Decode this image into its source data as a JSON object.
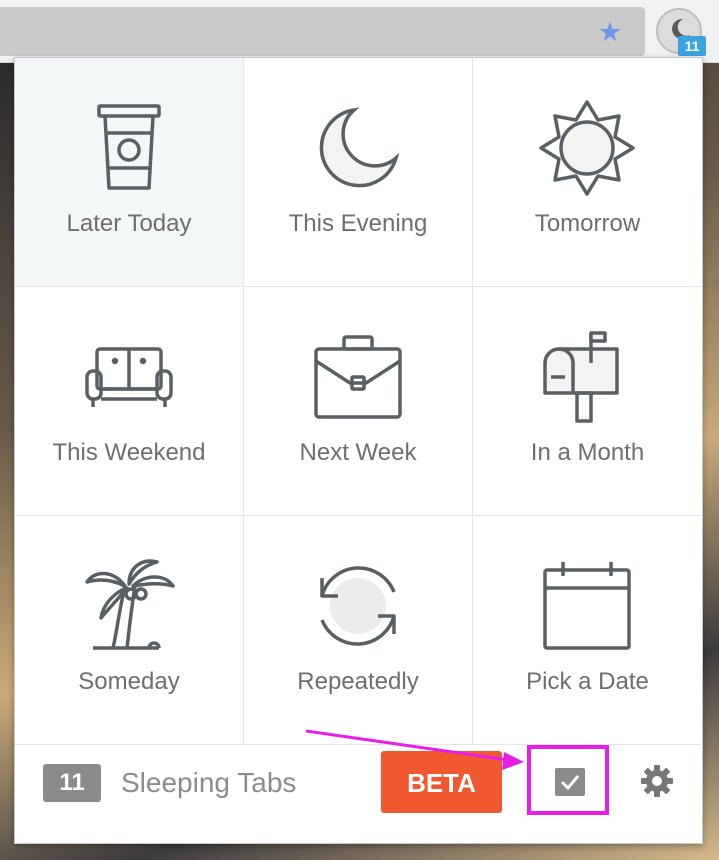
{
  "browser": {
    "extension_badge": "11",
    "icons": [
      "star-icon",
      "moon-extension-icon"
    ]
  },
  "popup": {
    "options": [
      {
        "label": "Later Today",
        "icon": "coffee-cup-icon"
      },
      {
        "label": "This Evening",
        "icon": "moon-icon"
      },
      {
        "label": "Tomorrow",
        "icon": "sun-icon"
      },
      {
        "label": "This Weekend",
        "icon": "sofa-icon"
      },
      {
        "label": "Next Week",
        "icon": "briefcase-icon"
      },
      {
        "label": "In a Month",
        "icon": "mailbox-icon"
      },
      {
        "label": "Someday",
        "icon": "palm-tree-icon"
      },
      {
        "label": "Repeatedly",
        "icon": "repeat-icon"
      },
      {
        "label": "Pick a Date",
        "icon": "calendar-icon"
      }
    ],
    "footer": {
      "count": "11",
      "sleeping_label": "Sleeping Tabs",
      "beta_label": "BETA",
      "icons": [
        "todo-checkbox-icon",
        "gear-icon"
      ]
    }
  },
  "colors": {
    "accent": "#f0582f",
    "highlight": "#e61ee6",
    "badge_blue": "#3aa3e0",
    "icon_stroke": "#5a5f63"
  }
}
